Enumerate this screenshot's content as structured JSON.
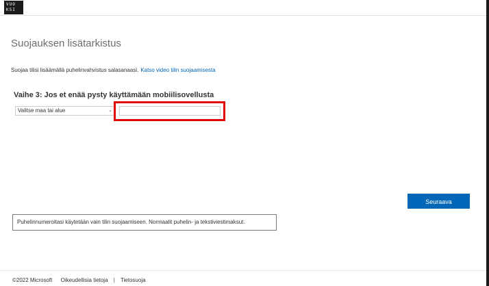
{
  "header": {
    "logo_line1": "VUO",
    "logo_line2": "KSI"
  },
  "main": {
    "title": "Suojauksen lisätarkistus",
    "info_text": "Suojaa tilisi lisäämällä puhelinvahvistus salasanaasi.",
    "info_link": "Katso video tilin suojaamisesta",
    "step_heading": "Vaihe 3: Jos et enää pysty käyttämään mobiilisovellusta",
    "country_select_value": "Valitse maa tai alue",
    "phone_input_value": "",
    "next_button": "Seuraava",
    "notice": "Puhelinnumeroitasi käytetään vain tilin suojaamiseen. Normaalit puhelin- ja tekstiviestimaksut."
  },
  "footer": {
    "copyright": "©2022 Microsoft",
    "legal_link": "Oikeudellisia tietoja",
    "separator": "|",
    "privacy_link": "Tietosuoja"
  },
  "colors": {
    "accent": "#0067b8",
    "highlight": "#e00000"
  },
  "icons": {
    "select_arrow": "chevron-down-icon"
  }
}
